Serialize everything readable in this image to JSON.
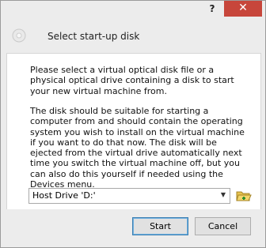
{
  "titlebar": {
    "help_label": "?",
    "close_label": "✕"
  },
  "header": {
    "icon": "disc-icon",
    "title": "Select start-up disk"
  },
  "body": {
    "paragraph1": "Please select a virtual optical disk file or a physical optical drive containing a disk to start your new virtual machine from.",
    "paragraph2": "The disk should be suitable for starting a computer from and should contain the operating system you wish to install on the virtual machine if you want to do that now. The disk will be ejected from the virtual drive automatically next time you switch the virtual machine off, but you can also do this yourself if needed using the Devices menu."
  },
  "disk_select": {
    "selected": "Host Drive 'D:'",
    "dropdown_icon": "chevron-down-icon",
    "folder_icon": "folder-open-icon"
  },
  "buttons": {
    "start": "Start",
    "cancel": "Cancel"
  },
  "colors": {
    "close_red": "#c7463b",
    "accent_blue": "#3c7fb1"
  }
}
